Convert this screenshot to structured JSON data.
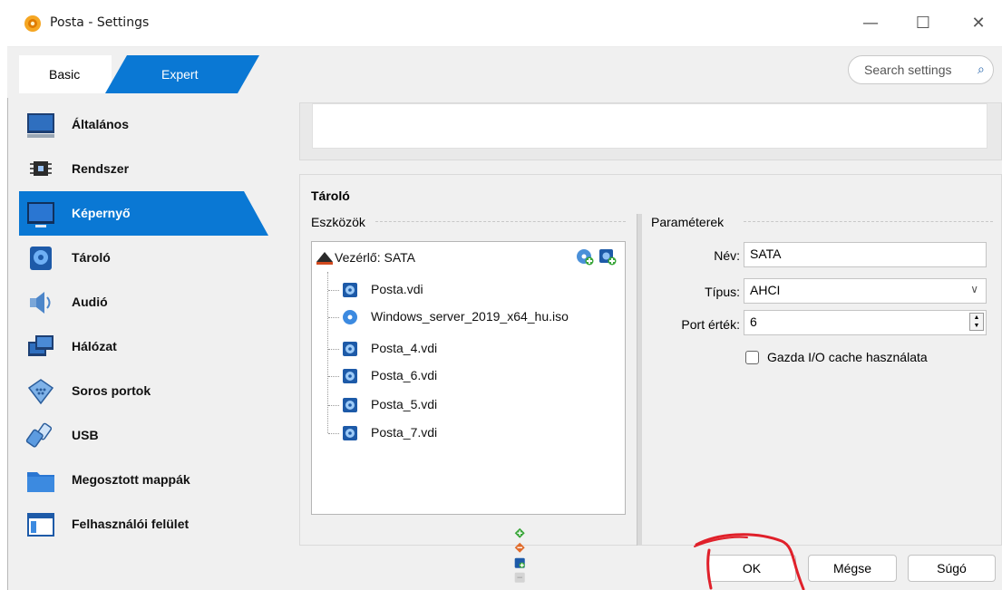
{
  "window": {
    "title": "Posta - Settings",
    "controls": {
      "minimize": "—",
      "maximize": "☐",
      "close": "✕"
    }
  },
  "mode_tabs": {
    "basic": "Basic",
    "expert": "Expert"
  },
  "search": {
    "placeholder": "Search settings"
  },
  "sidebar": {
    "items": [
      {
        "label": "Általános",
        "icon": "monitor-general-icon"
      },
      {
        "label": "Rendszer",
        "icon": "chip-icon"
      },
      {
        "label": "Képernyő",
        "icon": "display-icon",
        "active": true
      },
      {
        "label": "Tároló",
        "icon": "disk-icon"
      },
      {
        "label": "Audió",
        "icon": "speaker-icon"
      },
      {
        "label": "Hálózat",
        "icon": "network-icon"
      },
      {
        "label": "Soros portok",
        "icon": "serial-port-icon"
      },
      {
        "label": "USB",
        "icon": "usb-icon"
      },
      {
        "label": "Megosztott mappák",
        "icon": "folder-icon"
      },
      {
        "label": "Felhasználói felület",
        "icon": "window-ui-icon"
      }
    ]
  },
  "storage": {
    "title": "Tároló",
    "devices_legend": "Eszközök",
    "controller": "Vezérlő: SATA",
    "attachments": [
      {
        "name": "Posta.vdi",
        "type": "hdd"
      },
      {
        "name": "Windows_server_2019_x64_hu.iso",
        "type": "optical"
      },
      {
        "name": "Posta_4.vdi",
        "type": "hdd"
      },
      {
        "name": "Posta_6.vdi",
        "type": "hdd"
      },
      {
        "name": "Posta_5.vdi",
        "type": "hdd"
      },
      {
        "name": "Posta_7.vdi",
        "type": "hdd"
      }
    ],
    "params_legend": "Paraméterek",
    "name_label": "Név:",
    "name_value": "SATA",
    "type_label": "Típus:",
    "type_value": "AHCI",
    "port_label": "Port érték:",
    "port_value": "6",
    "cache_label": "Gazda I/O cache használata",
    "cache_checked": false
  },
  "buttons": {
    "ok": "OK",
    "cancel": "Mégse",
    "help": "Súgó"
  },
  "colors": {
    "accent": "#0a78d4",
    "annotation": "#e0202a"
  }
}
